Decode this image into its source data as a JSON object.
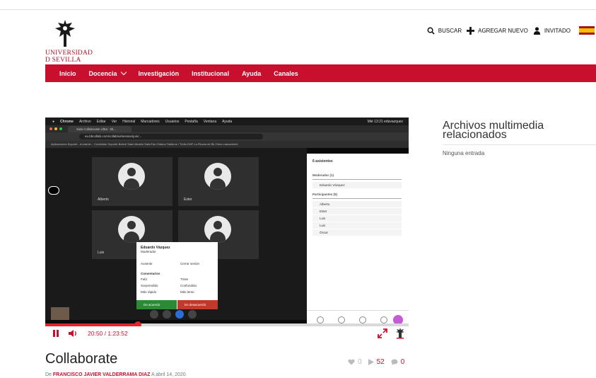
{
  "logo": {
    "line1": "UNIVERSIDAD",
    "line2": "D SEVILLA"
  },
  "header": {
    "search": "BUSCAR",
    "add_new": "AGREGAR NUEVO",
    "user": "INVITADO"
  },
  "nav": {
    "items": [
      {
        "label": "Inicio"
      },
      {
        "label": "Docencia"
      },
      {
        "label": "Investigación"
      },
      {
        "label": "Institucional"
      },
      {
        "label": "Ayuda"
      },
      {
        "label": "Canales"
      }
    ]
  },
  "screen": {
    "menubar": [
      "Chrome",
      "Archivo",
      "Editar",
      "Ver",
      "Historial",
      "Marcadores",
      "Usuarios",
      "Pestaña",
      "Ventana",
      "Ayuda"
    ],
    "clock": "Mié 13:21  eduvazquez",
    "tab_title": "Sala Collaborate Ultra - Bl...",
    "url": "eu.bbcollab.com/collab/ui/session/join/...",
    "bookmarks": "Aplicaciones   Soporte - eLearnin...   Contenido Soporte   Botiné   Sala Ultrablo   Sala Edu Clásica   Tableros / Trello   DNF   La Picaria de Bk   Otros marcadores",
    "tiles": [
      "Alberto",
      "Ester",
      "Luis",
      ""
    ],
    "menu": {
      "name": "Eduardo Vázquez",
      "role": "Moderador",
      "away": "Ausente",
      "logout": "Cerrar sesión",
      "comments_title": "Comentarios",
      "happy": "Feliz",
      "sad": "Triste",
      "surprised": "Sorprendido",
      "confused": "Confundido",
      "faster": "Más rápido",
      "slower": "Más lento",
      "agree": "De acuerdo",
      "disagree": "En desacuerdo"
    },
    "panel": {
      "title": "6 asistentes",
      "moderator_header": "Moderador (1)",
      "moderator": "Eduardo Vázquez",
      "participants_header": "Participantes (5)",
      "participants": [
        "Alberto",
        "Ester",
        "Luis",
        "Luis",
        "Óscar"
      ]
    }
  },
  "player": {
    "time": "20:50  / 1:23:52",
    "progress": 0.255
  },
  "media": {
    "title": "Collaborate",
    "byline_prefix": "De",
    "author": "FRANCISCO JAVIER VALDERRAMA DIAZ",
    "date": "A abril 14, 2020",
    "likes": "0",
    "plays": "52",
    "comments": "0"
  },
  "sidebar": {
    "title": "Archivos multimedia relacionados",
    "empty": "Ninguna entrada"
  },
  "colors": {
    "brand": "#c8102e",
    "agree": "#2a8a35",
    "disagree": "#c0392b"
  }
}
